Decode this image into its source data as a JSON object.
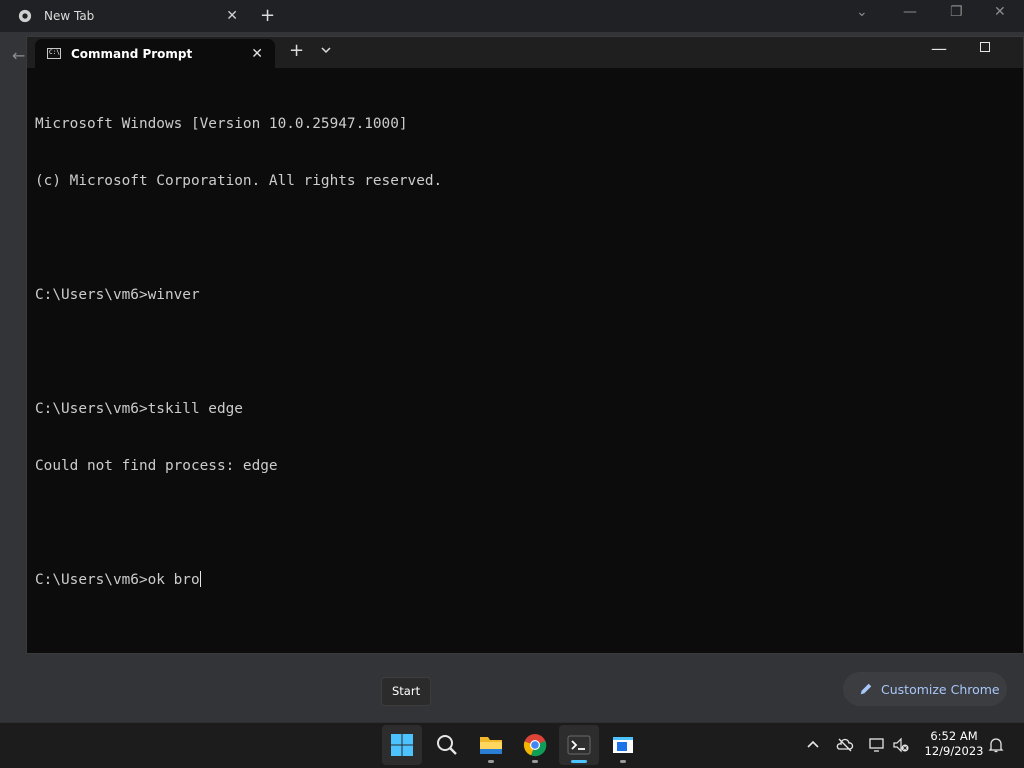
{
  "chrome": {
    "tab_title": "New Tab",
    "new_tab_symbol": "+",
    "customize_label": "Customize Chrome"
  },
  "terminal": {
    "tab_title": "Command Prompt",
    "close_symbol": "✕",
    "add_symbol": "+",
    "lines": [
      "Microsoft Windows [Version 10.0.25947.1000]",
      "(c) Microsoft Corporation. All rights reserved.",
      "",
      "C:\\Users\\vm6>winver",
      "",
      "C:\\Users\\vm6>tskill edge",
      "Could not find process: edge",
      "",
      "C:\\Users\\vm6>ok bro"
    ]
  },
  "tooltip": {
    "text": "Start"
  },
  "taskbar": {
    "apps": [
      {
        "icon": "windows-start-icon"
      },
      {
        "icon": "search-icon"
      },
      {
        "icon": "file-explorer-icon"
      },
      {
        "icon": "chrome-icon"
      },
      {
        "icon": "terminal-icon"
      },
      {
        "icon": "app-window-icon"
      }
    ],
    "time": "6:52 AM",
    "date": "12/9/2023"
  },
  "colors": {
    "accent": "#4cc2ff",
    "terminal_bg": "#0c0c0c",
    "chrome_link": "#a8c7fa"
  }
}
